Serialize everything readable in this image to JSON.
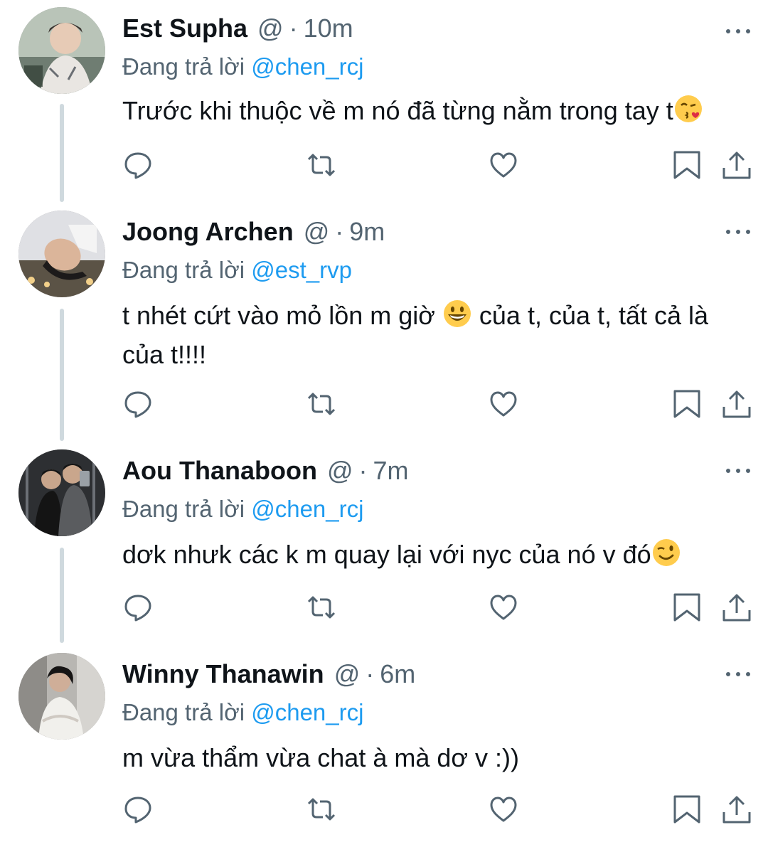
{
  "replies": [
    {
      "name": "Est Supha",
      "handle": "@",
      "separator": "·",
      "time": "10m",
      "replying_prefix": "Đang trả lời",
      "replying_to": "@chen_rcj",
      "text_before_emoji": "Trước khi thuộc về m nó đã từng nằm trong tay t",
      "emoji": "kissing-heart",
      "text_after_emoji": ""
    },
    {
      "name": "Joong Archen",
      "handle": "@",
      "separator": "·",
      "time": "9m",
      "replying_prefix": "Đang trả lời",
      "replying_to": "@est_rvp",
      "text_before_emoji": "t nhét cứt vào mỏ lồn m giờ ",
      "emoji": "grinning-face",
      "text_after_emoji": " của t, của t, tất cả là của t!!!!"
    },
    {
      "name": "Aou Thanaboon",
      "handle": "@",
      "separator": "·",
      "time": "7m",
      "replying_prefix": "Đang trả lời",
      "replying_to": "@chen_rcj",
      "text_before_emoji": "dơk nhưk các k m quay lại với nyc của nó v đó",
      "emoji": "winking-face",
      "text_after_emoji": ""
    },
    {
      "name": "Winny Thanawin",
      "handle": "@",
      "separator": "·",
      "time": "6m",
      "replying_prefix": "Đang trả lời",
      "replying_to": "@chen_rcj",
      "text_before_emoji": "m vừa thẩm vừa chat à mà dơ v :))",
      "emoji": "",
      "text_after_emoji": ""
    }
  ],
  "icons": {
    "reply": "reply-icon",
    "retweet": "retweet-icon",
    "like": "like-icon",
    "bookmark": "bookmark-icon",
    "share": "share-icon",
    "more": "more-icon"
  },
  "colors": {
    "text": "#0f1419",
    "secondary": "#536471",
    "accent": "#1d9bf0",
    "thread_line": "#cfd9de"
  }
}
